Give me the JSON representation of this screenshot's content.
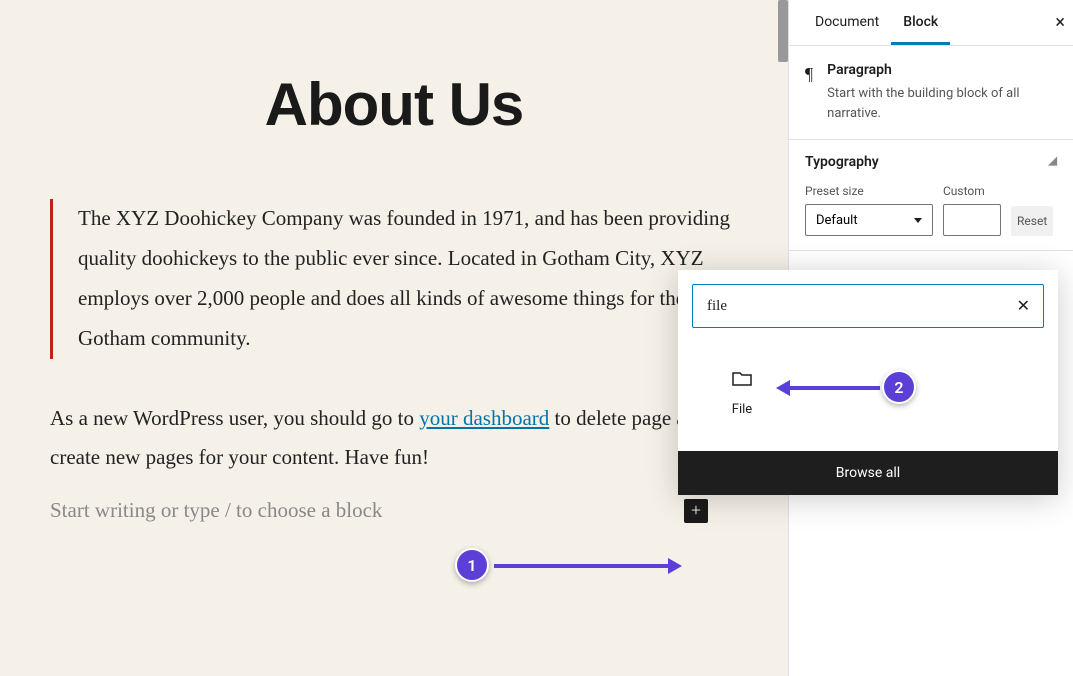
{
  "editor": {
    "page_title": "About Us",
    "quote_text": "The XYZ Doohickey Company was founded in 1971, and has been providing quality doohickeys to the public ever since. Located in Gotham City, XYZ employs over 2,000 people and does all kinds of awesome things for the Gotham community.",
    "paragraph_pre": "As a new WordPress user, you should go to ",
    "paragraph_link": "your dashboard",
    "paragraph_post": " to delete page and create new pages for your content. Have fun!",
    "placeholder_text": "Start writing or type / to choose a block",
    "add_block_label": "+"
  },
  "sidebar": {
    "tabs": {
      "document": "Document",
      "block": "Block"
    },
    "block_info": {
      "title": "Paragraph",
      "description": "Start with the building block of all narrative."
    },
    "typography": {
      "heading": "Typography",
      "preset_label": "Preset size",
      "preset_value": "Default",
      "custom_label": "Custom",
      "reset_label": "Reset"
    }
  },
  "inserter": {
    "search_value": "file",
    "result_label": "File",
    "browse_all": "Browse all"
  },
  "annotations": {
    "marker1": "1",
    "marker2": "2"
  }
}
